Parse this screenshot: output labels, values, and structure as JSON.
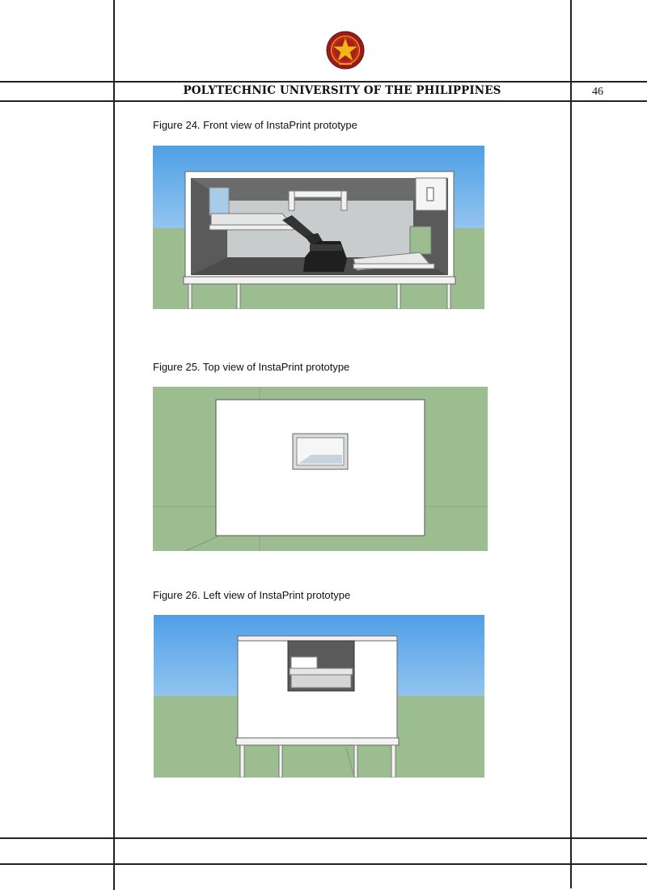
{
  "header": {
    "university": "POLYTECHNIC UNIVERSITY OF THE PHILIPPINES",
    "page_number": "46",
    "seal_icon": "pup-seal-icon"
  },
  "figures": [
    {
      "caption": "Figure 24. Front view of InstaPrint prototype"
    },
    {
      "caption": "Figure 25. Top view of InstaPrint prototype"
    },
    {
      "caption": "Figure 26. Left view of InstaPrint prototype"
    }
  ],
  "colors": {
    "sky_top": "#4f9fe6",
    "sky_bottom": "#cfe6f7",
    "ground": "#9bbd8f",
    "wall_dark": "#5a5a5a",
    "wall_light": "#c9cccc",
    "rule": "#222222",
    "seal_red": "#9b1b1b",
    "seal_gold": "#f2b51c"
  }
}
